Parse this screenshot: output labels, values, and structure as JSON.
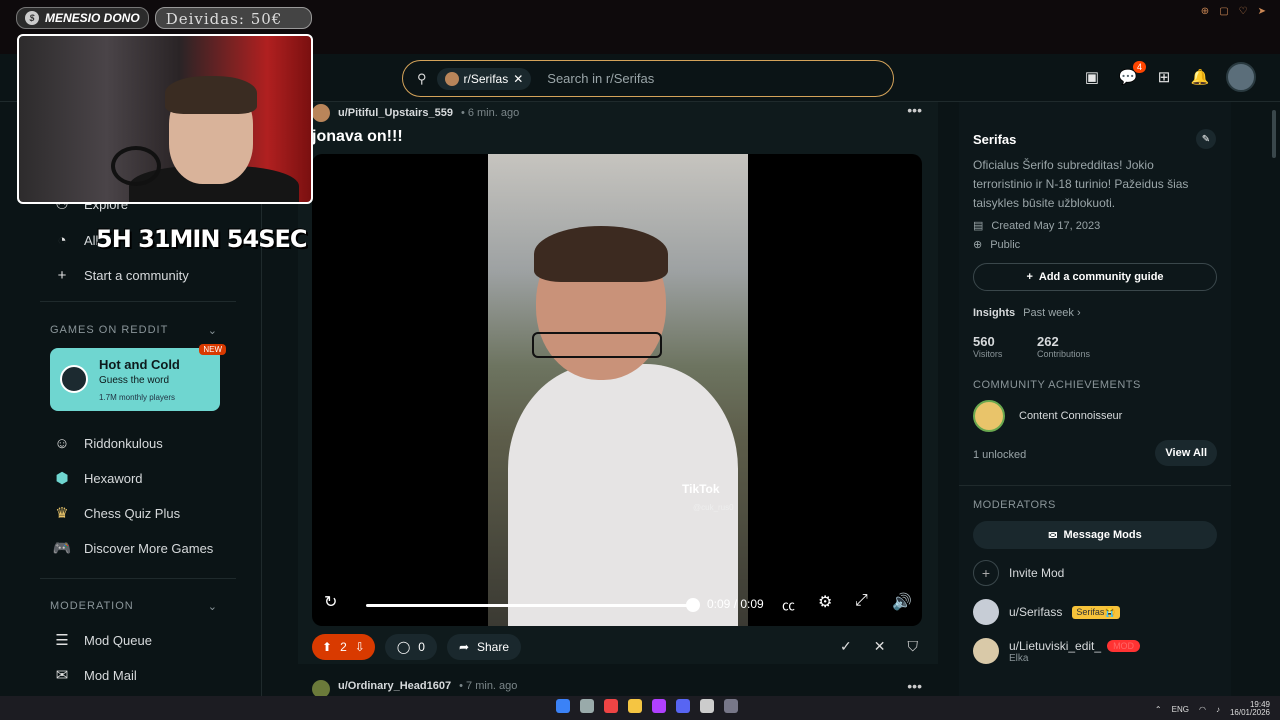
{
  "overlay": {
    "donor_label": "MENESIO DONO",
    "donate_label": "Deividas: 50€",
    "timer": "5H 31MIN 54SEC"
  },
  "header": {
    "search_chip": "r/Serifas",
    "search_placeholder": "Search in r/Serifas",
    "chat_badge": "4"
  },
  "sidebar": {
    "explore_label": "Explore",
    "all_label": "All",
    "start_community_label": "Start a community",
    "games_header": "GAMES ON REDDIT",
    "featured_game": {
      "title": "Hot and Cold",
      "subtitle": "Guess the word",
      "players": "1.7M monthly players",
      "badge": "NEW"
    },
    "games": [
      {
        "label": "Riddonkulous"
      },
      {
        "label": "Hexaword"
      },
      {
        "label": "Chess Quiz Plus"
      },
      {
        "label": "Discover More Games"
      }
    ],
    "moderation_header": "MODERATION",
    "mod_items": [
      {
        "label": "Mod Queue"
      },
      {
        "label": "Mod Mail"
      }
    ]
  },
  "post": {
    "username": "u/Pitiful_Upstairs_559",
    "time": "• 6 min. ago",
    "title": "jonava on!!!",
    "tiktok_label": "TikTok",
    "tiktok_handle": "@cuk_rus0",
    "video_time": "0:09 / 0:09",
    "video_progress": 1.0,
    "upvotes": "2",
    "comments": "0",
    "share_label": "Share"
  },
  "next_post": {
    "username": "u/Ordinary_Head1607",
    "time": "• 7 min. ago"
  },
  "community": {
    "name": "Serifas",
    "description": "Oficialus Šerifo subredditas! Jokio terroristinio ir N-18 turinio! Pažeidus šias taisykles būsite užblokuoti.",
    "created": "Created May 17, 2023",
    "visibility": "Public",
    "guide_button": "Add a community guide",
    "insights_label": "Insights",
    "insights_range": "Past week ›",
    "visitors_value": "560",
    "visitors_label": "Visitors",
    "contrib_value": "262",
    "contrib_label": "Contributions",
    "achievements_header": "COMMUNITY ACHIEVEMENTS",
    "achievement_name": "Content Connoisseur",
    "unlocked": "1 unlocked",
    "view_all": "View All",
    "moderators_header": "MODERATORS",
    "message_mods": "Message Mods",
    "invite_mod": "Invite Mod",
    "mods": [
      {
        "name": "u/Serifass",
        "flair": "Serifas😭"
      },
      {
        "name": "u/Lietuviski_edit_",
        "flair": "MOD",
        "sub": "Elka"
      }
    ]
  },
  "tray": {
    "lang": "ENG",
    "time": "19:49",
    "date": "16/01/2026"
  },
  "colors": {
    "accent": "#ff4500",
    "search_border": "#d4a35a",
    "game_card": "#6fd6d0"
  }
}
